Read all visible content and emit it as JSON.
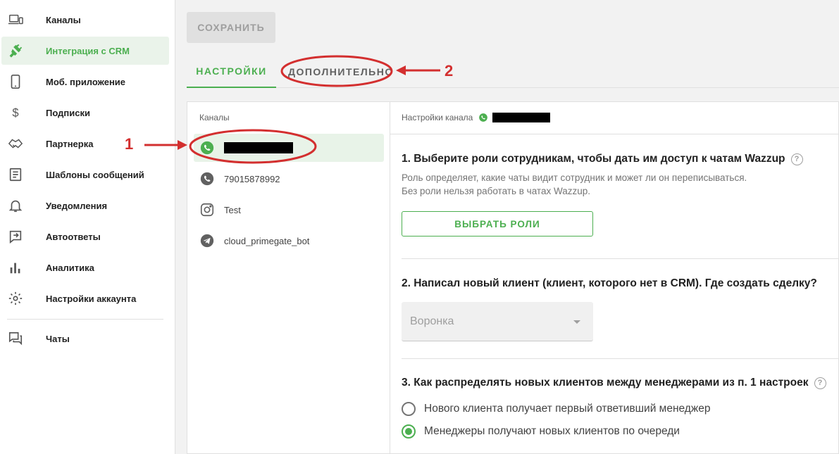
{
  "sidebar": {
    "items": [
      {
        "label": "Каналы",
        "icon": "devices-icon"
      },
      {
        "label": "Интеграция с CRM",
        "icon": "plug-icon",
        "active": true
      },
      {
        "label": "Моб. приложение",
        "icon": "phone-icon"
      },
      {
        "label": "Подписки",
        "icon": "dollar-icon"
      },
      {
        "label": "Партнерка",
        "icon": "handshake-icon"
      },
      {
        "label": "Шаблоны сообщений",
        "icon": "document-icon"
      },
      {
        "label": "Уведомления",
        "icon": "bell-icon"
      },
      {
        "label": "Автоответы",
        "icon": "auto-reply-icon"
      },
      {
        "label": "Аналитика",
        "icon": "bar-chart-icon"
      },
      {
        "label": "Настройки аккаунта",
        "icon": "gear-icon"
      },
      {
        "label": "Чаты",
        "icon": "chats-icon"
      }
    ]
  },
  "toolbar": {
    "save_label": "СОХРАНИТЬ"
  },
  "tabs": [
    {
      "label": "НАСТРОЙКИ",
      "active": true
    },
    {
      "label": "ДОПОЛНИТЕЛЬНО",
      "active": false
    }
  ],
  "channels": {
    "title": "Каналы",
    "items": [
      {
        "label": "",
        "icon": "whatsapp-icon",
        "active": true,
        "redacted": true
      },
      {
        "label": "79015878992",
        "icon": "whatsapp-icon"
      },
      {
        "label": "Test",
        "icon": "instagram-icon"
      },
      {
        "label": "cloud_primegate_bot",
        "icon": "telegram-icon"
      }
    ]
  },
  "settings": {
    "header": "Настройки канала",
    "q1": {
      "title": "1. Выберите роли сотрудникам, чтобы дать им доступ к чатам Wazzup",
      "desc_line1": "Роль определяет, какие чаты видит сотрудник и может ли он переписываться.",
      "desc_line2": "Без роли нельзя работать в чатах Wazzup.",
      "button": "ВЫБРАТЬ РОЛИ"
    },
    "q2": {
      "title": "2. Написал новый клиент (клиент, которого нет в CRM). Где создать сделку?",
      "select_value": "Воронка"
    },
    "q3": {
      "title": "3. Как распределять новых клиентов между менеджерами из п. 1 настроек",
      "options": [
        {
          "label": "Нового клиента получает первый ответивший менеджер",
          "checked": false
        },
        {
          "label": "Менеджеры получают новых клиентов по очереди",
          "checked": true
        }
      ]
    },
    "help_symbol": "?"
  },
  "annotations": {
    "marker1": "1",
    "marker2": "2"
  },
  "colors": {
    "accent": "#4caf50",
    "annotation": "#d32f2f",
    "redaction": "#000000"
  }
}
